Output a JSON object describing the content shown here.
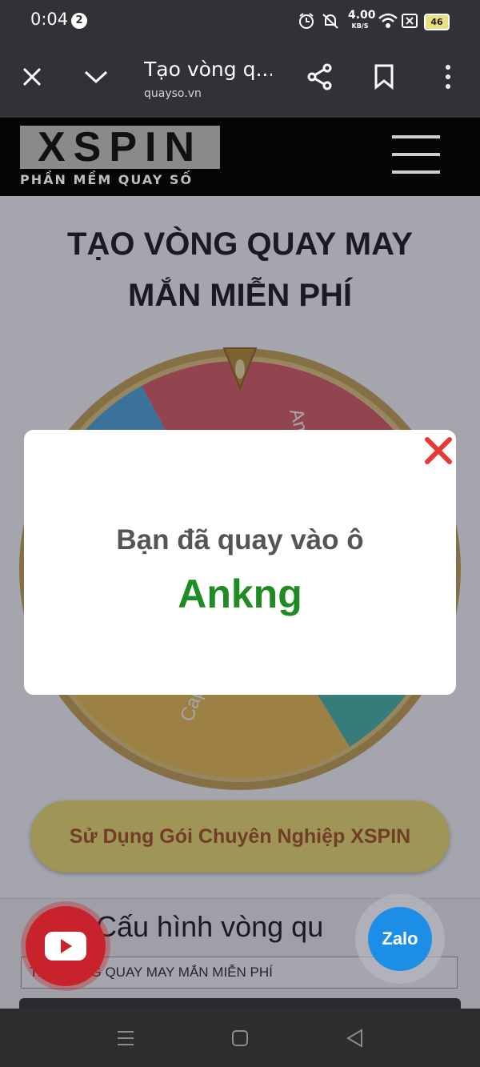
{
  "status_bar": {
    "time": "0:04",
    "notification_count": "2",
    "network_speed": "4.00",
    "network_unit": "KB/S",
    "battery": "46"
  },
  "browser": {
    "tab_title": "Tạo vòng q...",
    "url": "quayso.vn"
  },
  "site": {
    "logo_text": "XSPIN",
    "logo_tagline": "PHẦN MỀM QUAY SỐ"
  },
  "page": {
    "title_line1": "TẠO VÒNG QUAY MAY",
    "title_line2": "MẮN MIỄN PHÍ",
    "wheel_labels": [
      "Ankng",
      "Capthy"
    ],
    "pro_button_label": "Sử Dụng Gói Chuyên Nghiệp XSPIN",
    "config_title": "Cấu hình vòng qu",
    "wheel_name_value": "TẠO VÒNG QUAY MAY MẮN MIỄN PHÍ"
  },
  "modal": {
    "message": "Bạn đã quay vào ô",
    "result": "Ankng"
  },
  "floating": {
    "zalo_label": "Zalo"
  },
  "colors": {
    "wheel_red": "#e05a5e",
    "wheel_blue": "#49a7e0",
    "wheel_yellow": "#f1c24a",
    "wheel_teal": "#3fb8a8",
    "result_green": "#1f8b22",
    "close_red": "#e53935"
  }
}
